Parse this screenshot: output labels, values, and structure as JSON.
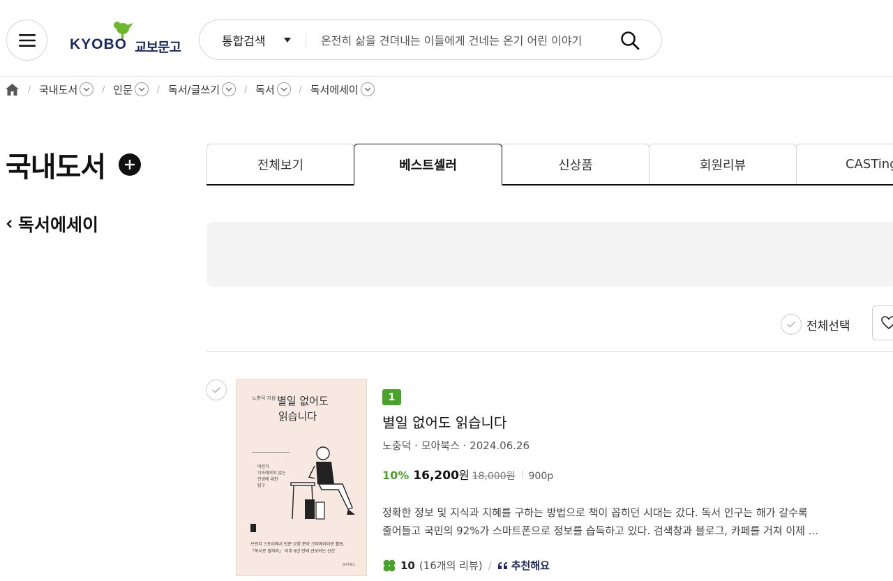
{
  "header": {
    "logo_text": "KYOBO",
    "logo_kr": "교보문고",
    "search_category": "통합검색",
    "search_placeholder": "온전히 삶을 견뎌내는 이들에게 건네는 온기 어린 이야기"
  },
  "breadcrumb": {
    "items": [
      {
        "label": "국내도서"
      },
      {
        "label": "인문"
      },
      {
        "label": "독서/글쓰기"
      },
      {
        "label": "독서"
      },
      {
        "label": "독서에세이"
      }
    ],
    "separator": "/"
  },
  "category": {
    "title": "국내도서",
    "back_label": "독서에세이"
  },
  "tabs": [
    {
      "label": "전체보기",
      "active": false
    },
    {
      "label": "베스트셀러",
      "active": true
    },
    {
      "label": "신상품",
      "active": false
    },
    {
      "label": "회원리뷰",
      "active": false
    },
    {
      "label": "CASTing",
      "active": false
    }
  ],
  "list": {
    "select_all_label": "전체선택"
  },
  "product": {
    "rank": "1",
    "title": "별일 없어도 읽습니다",
    "meta": "노충덕 · 모아북스 · 2024.06.26",
    "discount": "10%",
    "sale_price": "16,200",
    "price_unit": "원",
    "original_price": "18,000원",
    "pages": "900p",
    "desc_line1": "정확한 정보 및 지식과 지혜를 구하는 방법으로 책이 꼽히던 시대는 갔다. 독서 인구는 해가 갈수록",
    "desc_line2": "줄어들고 국민의 92%가 스마트폰으로 정보를 습득하고 있다. 검색창과 블로그, 카페를 거쳐 이제 ...",
    "review_score": "10",
    "review_count": "(16개의 리뷰)",
    "review_sep": "/",
    "recommend_label": "추천해요",
    "cover": {
      "author": "노충덕 지음",
      "title_line1": "별일 없어도",
      "title_line2": "읽습니다",
      "sub_line1": "여전히",
      "sub_line2": "익숙해지지 않는",
      "sub_line3": "인생에 대한",
      "sub_line4": "탐구",
      "blurb_line1": "브런치 스토리에서 인문·교양 분야 크리에이터로 활동,",
      "blurb_line2": "『독서로 말하라』 이후 6년 만에 선보이는 신간",
      "publisher": "모아북스"
    }
  },
  "colors": {
    "accent_green": "#49a32b",
    "brand_navy": "#1b2a5e"
  }
}
